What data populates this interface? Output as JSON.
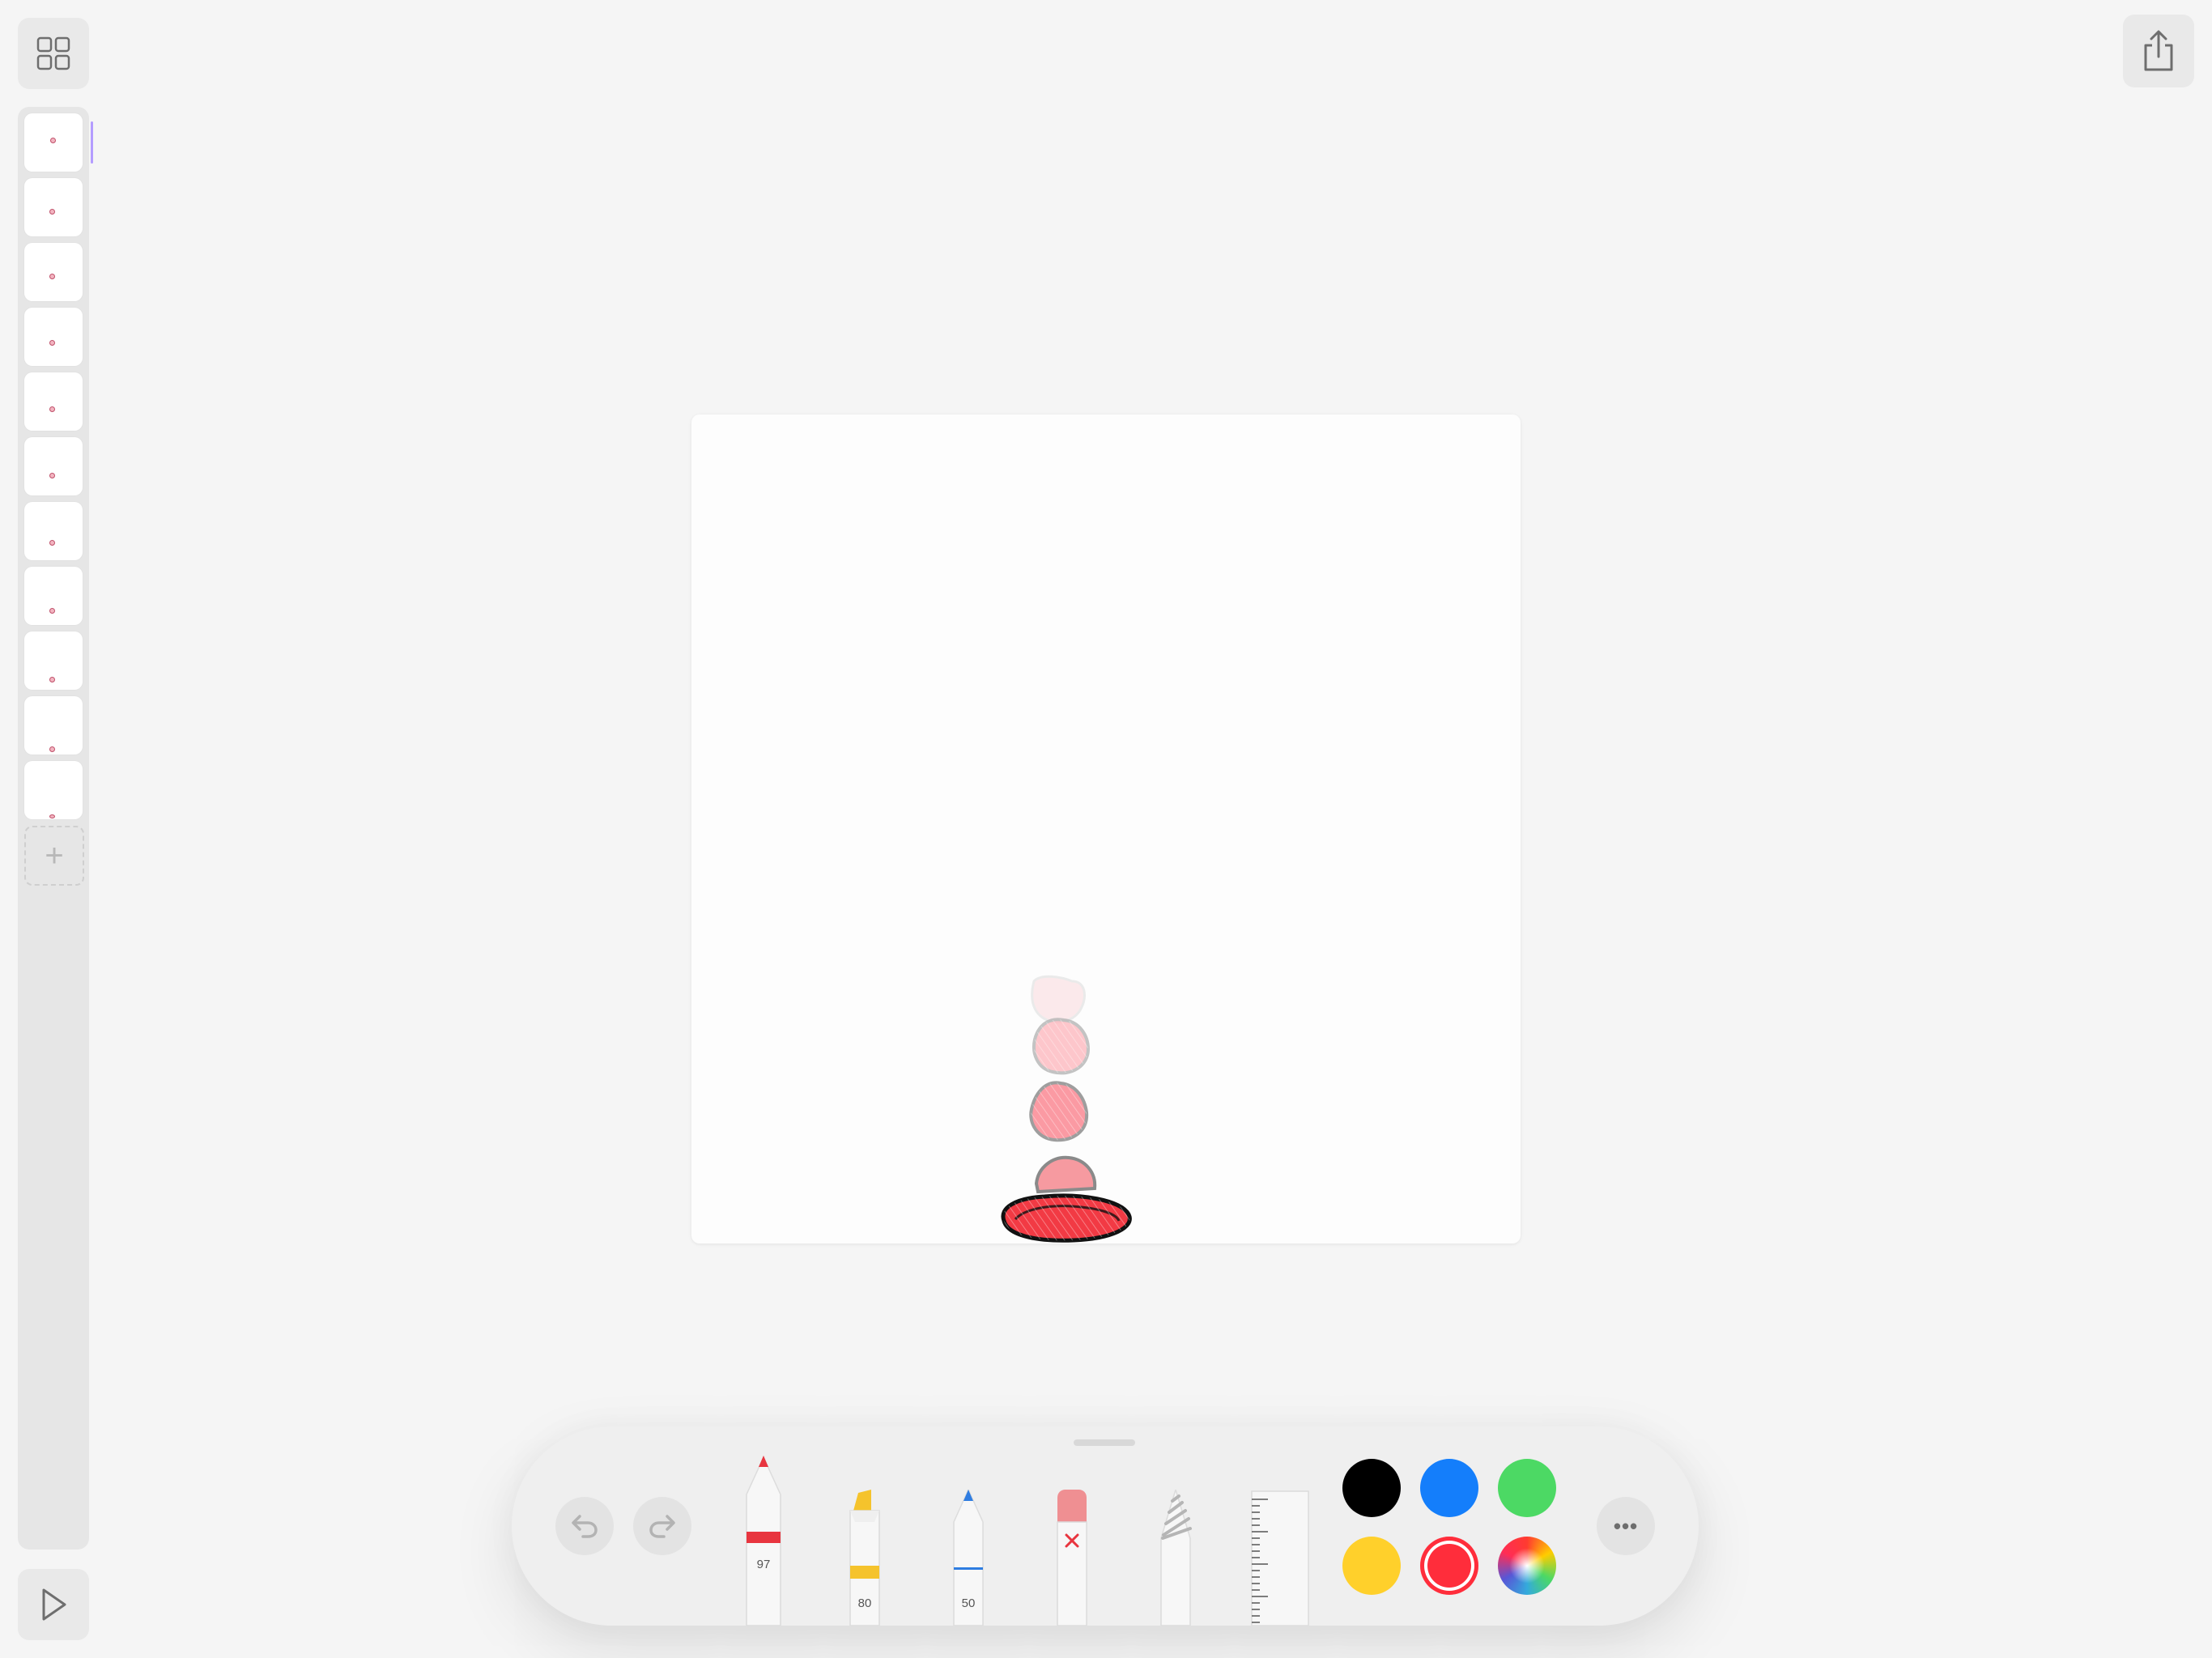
{
  "app": {
    "icons": {
      "frames_grid": "grid-icon",
      "share": "share-icon",
      "play": "play-icon",
      "add_frame": "plus-icon",
      "undo": "undo-icon",
      "redo": "redo-icon",
      "more": "ellipsis-icon"
    }
  },
  "frames": {
    "count": 11,
    "selected_index": 0,
    "add_label": "+"
  },
  "toolbar": {
    "tools": [
      {
        "name": "pen",
        "color": "#e8353f",
        "value": "97"
      },
      {
        "name": "marker",
        "color": "#f5c32c",
        "value": "80"
      },
      {
        "name": "pencil",
        "color": "#2f7de1",
        "value": "50"
      },
      {
        "name": "eraser",
        "color": "#ef8f92",
        "value": ""
      },
      {
        "name": "lasso",
        "color": "#bdbdbd",
        "value": ""
      },
      {
        "name": "ruler",
        "color": "#f2f2f2",
        "value": ""
      }
    ],
    "colors": [
      "#000000",
      "#147efb",
      "#4cd964",
      "#ffd02b",
      "#ff2d3b",
      "color-wheel"
    ],
    "selected_color": "#ff2d3b",
    "more_label": "•••"
  }
}
